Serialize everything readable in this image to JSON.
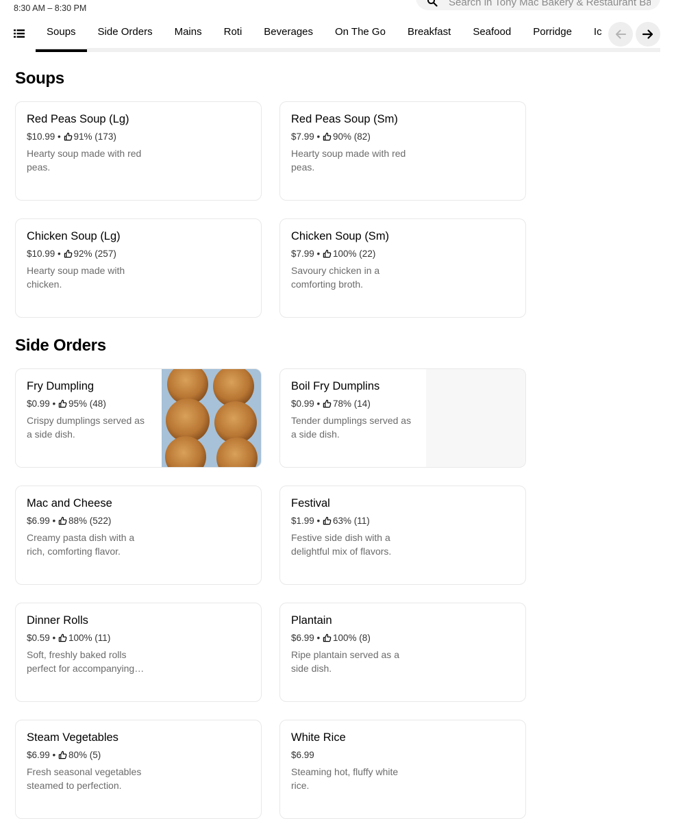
{
  "store": {
    "hours": "8:30 AM – 8:30 PM",
    "search_placeholder": "Search in Tony Mac Bakery & Restaurant Bara"
  },
  "tabs": [
    "Soups",
    "Side Orders",
    "Mains",
    "Roti",
    "Beverages",
    "On The Go",
    "Breakfast",
    "Seafood",
    "Porridge",
    "Ic"
  ],
  "active_tab": "Soups",
  "sections": [
    {
      "title": "Soups",
      "items": [
        {
          "name": "Red Peas Soup (Lg)",
          "price": "$10.99",
          "rating": "91% (173)",
          "desc": "Hearty soup made with red peas."
        },
        {
          "name": "Red Peas Soup (Sm)",
          "price": "$7.99",
          "rating": "90% (82)",
          "desc": "Hearty soup made with red peas."
        },
        {
          "name": "Chicken Soup (Lg)",
          "price": "$10.99",
          "rating": "92% (257)",
          "desc": "Hearty soup made with chicken."
        },
        {
          "name": "Chicken Soup (Sm)",
          "price": "$7.99",
          "rating": "100% (22)",
          "desc": "Savoury chicken in a comforting broth."
        }
      ]
    },
    {
      "title": "Side Orders",
      "items": [
        {
          "name": "Fry Dumpling",
          "price": "$0.99",
          "rating": "95% (48)",
          "desc": "Crispy dumplings served as a side dish."
        },
        {
          "name": "Boil Fry Dumplins",
          "price": "$0.99",
          "rating": "78% (14)",
          "desc": "Tender dumplings served as a side dish."
        },
        {
          "name": "Mac and Cheese",
          "price": "$6.99",
          "rating": "88% (522)",
          "desc": "Creamy pasta dish with a rich, comforting flavor."
        },
        {
          "name": "Festival",
          "price": "$1.99",
          "rating": "63% (11)",
          "desc": "Festive side dish with a delightful mix of flavors."
        },
        {
          "name": "Dinner Rolls",
          "price": "$0.59",
          "rating": "100% (11)",
          "desc": "Soft, freshly baked rolls perfect for accompanying any meal."
        },
        {
          "name": "Plantain",
          "price": "$6.99",
          "rating": "100% (8)",
          "desc": "Ripe plantain served as a side dish."
        },
        {
          "name": "Steam Vegetables",
          "price": "$6.99",
          "rating": "80% (5)",
          "desc": "Fresh seasonal vegetables steamed to perfection."
        },
        {
          "name": "White Rice",
          "price": "$6.99",
          "rating": "",
          "desc": "Steaming hot, fluffy white rice."
        }
      ]
    }
  ],
  "icons": {
    "search": "search-icon",
    "menu_list": "list-icon",
    "rating": "thumbs-up-icon",
    "prev": "arrow-left-icon",
    "next": "arrow-right-icon"
  },
  "colors": {
    "text": "#000000",
    "muted": "#6b6b6b",
    "border": "#e8e8e8",
    "pill_bg": "#eeeeee"
  }
}
